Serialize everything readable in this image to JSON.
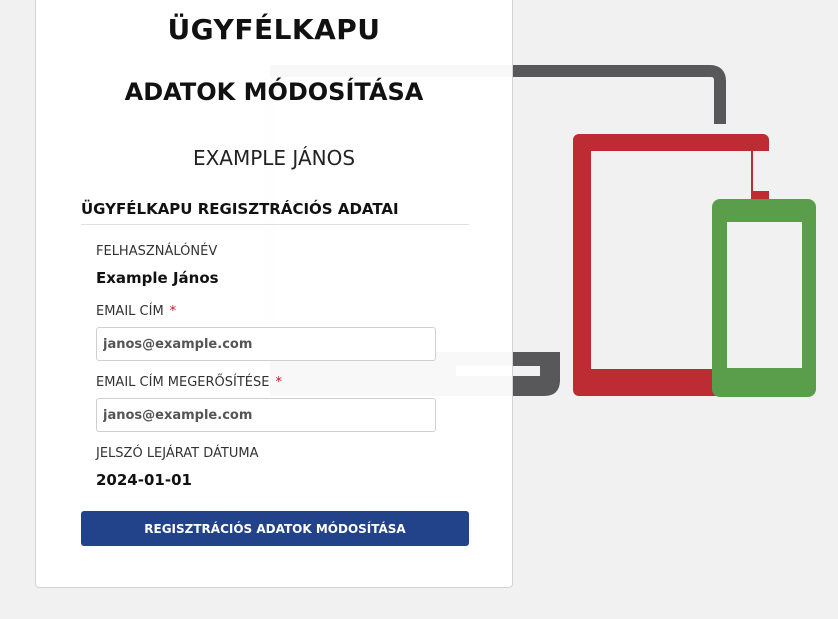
{
  "app": {
    "title": "ÜGYFÉLKAPU"
  },
  "page": {
    "title": "ADATOK MÓDOSÍTÁSA",
    "user_name": "EXAMPLE JÁNOS"
  },
  "section": {
    "title": "ÜGYFÉLKAPU REGISZTRÁCIÓS ADATAI"
  },
  "fields": {
    "username_label": "FELHASZNÁLÓNÉV",
    "username_value": "Example János",
    "email_label": "EMAIL CÍM",
    "email_value": "janos@example.com",
    "email_confirm_label": "EMAIL CÍM MEGERŐSÍTÉSE",
    "email_confirm_value": "janos@example.com",
    "password_expiry_label": "JELSZÓ LEJÁRAT DÁTUMA",
    "password_expiry_value": "2024-01-01",
    "required_mark": "*"
  },
  "actions": {
    "submit_label": "REGISZTRÁCIÓS ADATOK MÓDOSÍTÁSA"
  },
  "colors": {
    "primary_button": "#22428a",
    "required": "#c0141b",
    "laptop": "#58585a",
    "tablet": "#bd2b33",
    "phone": "#5a9e4b"
  },
  "illustration": {
    "icons": [
      "laptop-icon",
      "tablet-icon",
      "phone-icon"
    ]
  }
}
